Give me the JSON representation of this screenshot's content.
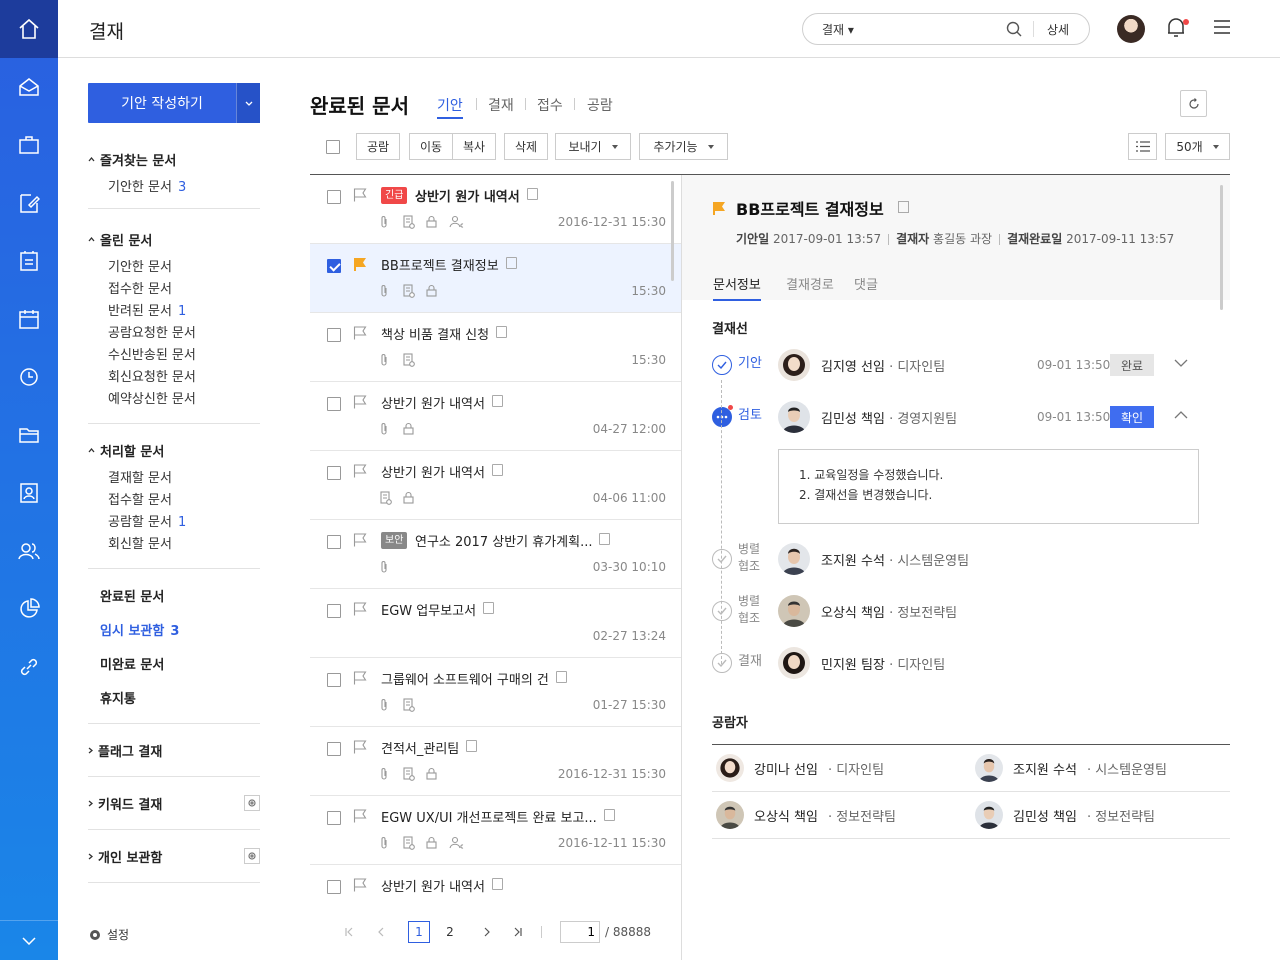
{
  "app": {
    "title": "결재"
  },
  "search": {
    "scope": "결재",
    "placeholder": "",
    "detail_label": "상세"
  },
  "nav_icons": [
    "home-icon",
    "mail-icon",
    "briefcase-icon",
    "approval-icon",
    "notepad-icon",
    "calendar-icon",
    "history-icon",
    "folder-icon",
    "contact-icon",
    "people-icon",
    "pie-chart-icon",
    "link-icon"
  ],
  "sidebar": {
    "write_button": "기안 작성하기",
    "groups": [
      {
        "title": "즐겨찾는 문서",
        "items": [
          {
            "label": "기안한 문서",
            "count": "3"
          }
        ]
      },
      {
        "title": "올린 문서",
        "items": [
          {
            "label": "기안한 문서",
            "count": ""
          },
          {
            "label": "접수한 문서",
            "count": ""
          },
          {
            "label": "반려된 문서",
            "count": "1"
          },
          {
            "label": "공람요청한 문서",
            "count": ""
          },
          {
            "label": "수신반송된 문서",
            "count": ""
          },
          {
            "label": "회신요청한 문서",
            "count": ""
          },
          {
            "label": "예약상신한 문서",
            "count": ""
          }
        ]
      },
      {
        "title": "처리할 문서",
        "items": [
          {
            "label": "결재할 문서",
            "count": ""
          },
          {
            "label": "접수할 문서",
            "count": ""
          },
          {
            "label": "공람할 문서",
            "count": "1"
          },
          {
            "label": "회신할 문서",
            "count": ""
          }
        ]
      }
    ],
    "main_items": [
      {
        "label": "완료된 문서",
        "count": ""
      },
      {
        "label": "임시 보관함",
        "count": "3"
      },
      {
        "label": "미완료 문서",
        "count": ""
      },
      {
        "label": "휴지통",
        "count": ""
      }
    ],
    "collapsed_groups": [
      "플래그 결재",
      "키워드 결재",
      "개인 보관함"
    ],
    "settings": "설정"
  },
  "content": {
    "title": "완료된 문서",
    "tabs": [
      "기안",
      "결재",
      "접수",
      "공람"
    ],
    "toolbar": {
      "buttons": [
        "공람",
        "이동",
        "복사",
        "삭제",
        "보내기",
        "추가기능"
      ],
      "page_size": "50개"
    }
  },
  "documents": [
    {
      "subject": "상반기 원가 내역서",
      "tag": "긴급",
      "date": "2016-12-31 15:30",
      "icons": [
        "clip",
        "doc",
        "lock",
        "cc"
      ],
      "checked": false,
      "flagged": false
    },
    {
      "subject": "BB프로젝트 결재정보",
      "tag": "",
      "date": "15:30",
      "icons": [
        "clip",
        "doc",
        "lock"
      ],
      "checked": true,
      "flagged": true
    },
    {
      "subject": "책상 비품 결재 신청",
      "tag": "",
      "date": "15:30",
      "icons": [
        "clip",
        "doc"
      ],
      "checked": false,
      "flagged": false
    },
    {
      "subject": "상반기 원가 내역서",
      "tag": "",
      "date": "04-27 12:00",
      "icons": [
        "clip",
        "lock"
      ],
      "checked": false,
      "flagged": false
    },
    {
      "subject": "상반기 원가 내역서",
      "tag": "",
      "date": "04-06 11:00",
      "icons": [
        "doc",
        "lock"
      ],
      "checked": false,
      "flagged": false
    },
    {
      "subject": "연구소 2017 상반기 휴가계획...",
      "tag": "보안",
      "date": "03-30 10:10",
      "icons": [
        "clip"
      ],
      "checked": false,
      "flagged": false
    },
    {
      "subject": "EGW 업무보고서",
      "tag": "",
      "date": "02-27 13:24",
      "icons": [],
      "checked": false,
      "flagged": false
    },
    {
      "subject": "그룹웨어 소프트웨어 구매의 건",
      "tag": "",
      "date": "01-27 15:30",
      "icons": [
        "clip",
        "doc"
      ],
      "checked": false,
      "flagged": false
    },
    {
      "subject": "견적서_관리팀",
      "tag": "",
      "date": "2016-12-31 15:30",
      "icons": [
        "clip",
        "doc",
        "lock"
      ],
      "checked": false,
      "flagged": false
    },
    {
      "subject": "EGW UX/UI 개선프로젝트 완료 보고...",
      "tag": "",
      "date": "2016-12-11 15:30",
      "icons": [
        "clip",
        "doc",
        "lock",
        "cc"
      ],
      "checked": false,
      "flagged": false
    },
    {
      "subject": "상반기 원가 내역서",
      "tag": "",
      "date": "",
      "icons": [],
      "checked": false,
      "flagged": false
    }
  ],
  "pagination": {
    "pages": [
      "1",
      "2"
    ],
    "current": "1",
    "total": "/ 88888"
  },
  "detail": {
    "title": "BB프로젝트 결재정보",
    "meta": [
      {
        "label": "기안일",
        "value": "2017-09-01 13:57"
      },
      {
        "label": "결재자",
        "value": "홍길동 과장"
      },
      {
        "label": "결재완료일",
        "value": "2017-09-11 13:57"
      }
    ],
    "tabs": [
      "문서정보",
      "결재경로",
      "댓글"
    ],
    "approval_line_title": "결재선",
    "steps": [
      {
        "status": "기안",
        "name": "김지영 선임",
        "dept": "· 디자인팀",
        "time": "09-01 13:50",
        "badge": "완료"
      },
      {
        "status": "검토",
        "name": "김민성 책임",
        "dept": "· 경영지원팀",
        "time": "09-01 13:50",
        "badge": "확인"
      },
      {
        "status": "병렬\n협조",
        "name": "조지원 수석",
        "dept": "· 시스템운영팀",
        "time": "",
        "badge": ""
      },
      {
        "status": "병렬\n협조",
        "name": "오상식 책임",
        "dept": "· 정보전략팀",
        "time": "",
        "badge": ""
      },
      {
        "status": "결재",
        "name": "민지원 팀장",
        "dept": "· 디자인팀",
        "time": "",
        "badge": ""
      }
    ],
    "comment": [
      "1. 교육일정을 수정했습니다.",
      "2. 결재선을 변경했습니다."
    ],
    "viewers_title": "공람자",
    "viewers": [
      {
        "name": "강미나 선임",
        "dept": "· 디자인팀"
      },
      {
        "name": "조지원 수석",
        "dept": "· 시스템운영팀"
      },
      {
        "name": "오상식 책임",
        "dept": "· 정보전략팀"
      },
      {
        "name": "김민성 책임",
        "dept": "· 정보전략팀"
      }
    ]
  },
  "colors": {
    "accent": "#2f5fe0",
    "rail_top": "#2a5fe0",
    "rail_bottom": "#1a86e8",
    "urgent": "#f04848",
    "secure": "#888888",
    "flag": "#f5a623"
  }
}
